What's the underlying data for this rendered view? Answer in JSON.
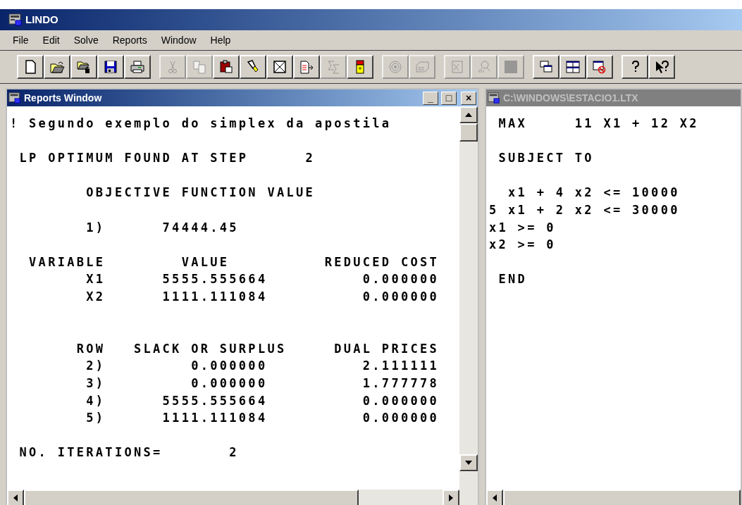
{
  "window": {
    "title": "LINDO"
  },
  "menu": [
    {
      "label": "File"
    },
    {
      "label": "Edit"
    },
    {
      "label": "Solve"
    },
    {
      "label": "Reports"
    },
    {
      "label": "Window"
    },
    {
      "label": "Help"
    }
  ],
  "toolbar": [
    [
      {
        "disabled": false
      },
      {
        "disabled": false
      },
      {
        "disabled": false
      },
      {
        "disabled": false
      },
      {
        "disabled": false
      }
    ],
    [
      {
        "disabled": true
      },
      {
        "disabled": true
      },
      {
        "disabled": false
      },
      {
        "disabled": false
      },
      {
        "disabled": false
      },
      {
        "disabled": false
      },
      {
        "disabled": true
      },
      {
        "disabled": false
      }
    ],
    [
      {
        "disabled": true
      },
      {
        "disabled": true
      }
    ],
    [
      {
        "disabled": true
      },
      {
        "disabled": true
      },
      {
        "disabled": true
      }
    ],
    [
      {
        "disabled": false
      },
      {
        "disabled": false
      },
      {
        "disabled": false
      }
    ],
    [
      {
        "disabled": false
      },
      {
        "disabled": false
      }
    ]
  ],
  "reports_window": {
    "title": "Reports Window",
    "active": true,
    "controls": [
      "_",
      "□",
      "×"
    ],
    "content": "! Segundo exemplo do simplex da apostila\n\n LP OPTIMUM FOUND AT STEP      2\n\n        OBJECTIVE FUNCTION VALUE\n\n        1)      74444.45\n\n  VARIABLE        VALUE          REDUCED COST\n        X1      5555.555664          0.000000\n        X2      1111.111084          0.000000\n\n\n       ROW   SLACK OR SURPLUS     DUAL PRICES\n        2)         0.000000          2.111111\n        3)         0.000000          1.777778\n        4)      5555.555664          0.000000\n        5)      1111.111084          0.000000\n\n NO. ITERATIONS=       2"
  },
  "model_window": {
    "title": "C:\\WINDOWS\\ESTACIO1.LTX",
    "active": false,
    "content": " MAX     11 X1 + 12 X2\n\n SUBJECT TO\n\n  x1 + 4 x2 <= 10000\n5 x1 + 2 x2 <= 30000\nx1 >= 0\nx2 >= 0\n\n END"
  }
}
